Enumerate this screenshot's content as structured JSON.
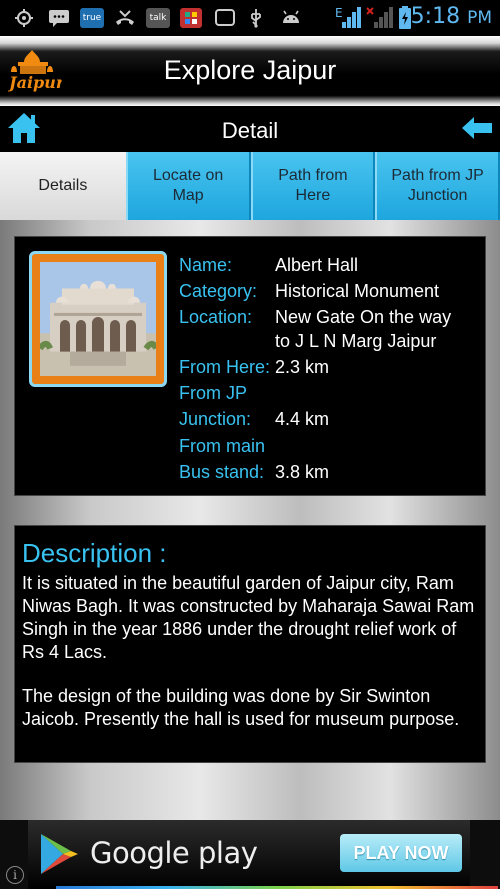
{
  "status_bar": {
    "time": "5:18",
    "time_suffix": "PM",
    "app_true_label": "true",
    "app_talk_label": "talk",
    "network_e_label": "E"
  },
  "app": {
    "logo_text": "Jaipur",
    "title": "Explore Jaipur"
  },
  "nav": {
    "title": "Detail"
  },
  "tabs": [
    {
      "label": "Details"
    },
    {
      "label": "Locate on Map"
    },
    {
      "label": "Path from Here"
    },
    {
      "label": "Path from JP Junction"
    }
  ],
  "info": {
    "name_label": "Name:",
    "name_value": "Albert Hall",
    "category_label": "Category:",
    "category_value": "Historical Monument",
    "location_label": "Location:",
    "location_value_line1": "New Gate On the way",
    "location_value_line2": "to J L N Marg Jaipur",
    "from_here_label": "From Here:",
    "from_here_value": "2.3 km",
    "from_jp_label_line1": "From JP",
    "from_jp_label_line2": "Junction:",
    "from_jp_value": "4.4 km",
    "from_main_label_line1": "From main",
    "from_main_label_line2": "Bus stand:",
    "from_main_value": "3.8 km"
  },
  "description": {
    "title": "Description :",
    "paragraph1": "It is situated in the beautiful garden of Jaipur city, Ram Niwas Bagh. It was constructed by Maharaja Sawai Ram Singh in the year 1886 under the drought relief work of Rs 4 Lacs.",
    "paragraph2": "The design of the building was done by Sir Swinton Jaicob. Presently the hall is used for museum purpose."
  },
  "ad": {
    "brand_text": "Google play",
    "cta_label": "PLAY NOW",
    "info_symbol": "i"
  },
  "colors": {
    "accent": "#39c2f0",
    "tab_blue": "#1ea6de",
    "logo_orange": "#f08a10"
  }
}
